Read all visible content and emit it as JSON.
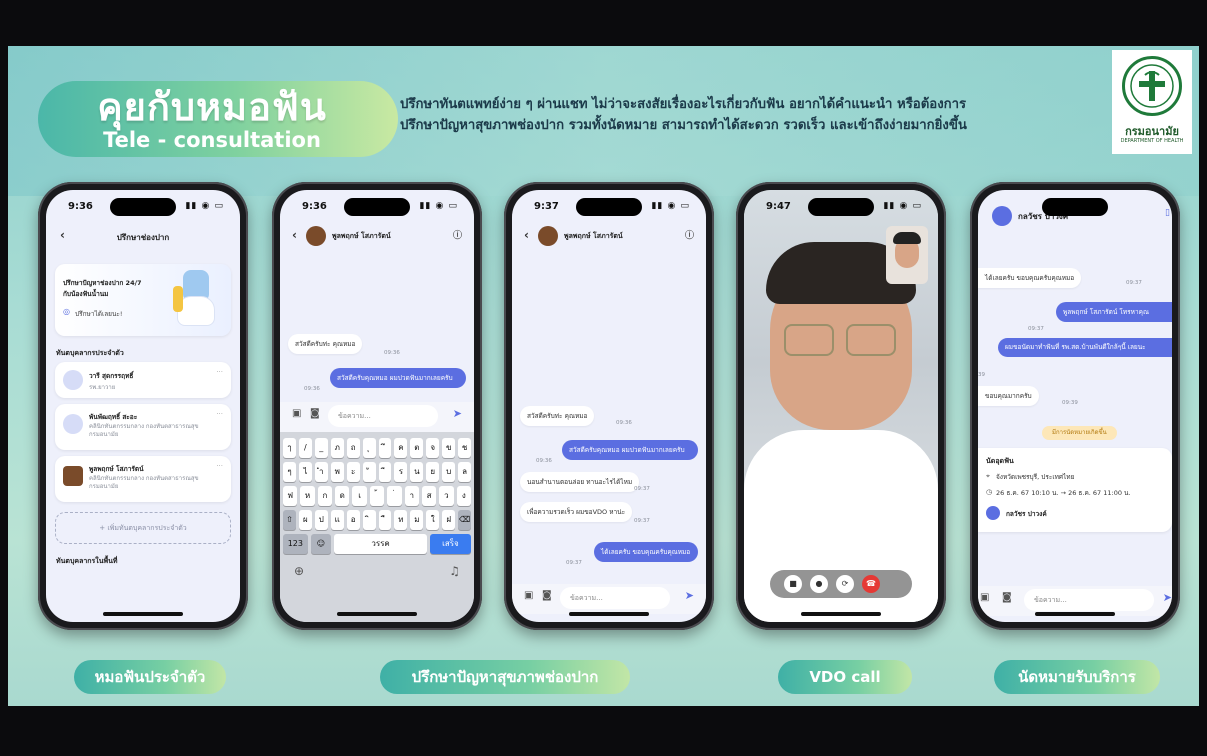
{
  "header": {
    "title_th": "คุยกับหมอฟัน",
    "title_en": "Tele - consultation",
    "description_line1": "ปรึกษาทันตแพทย์ง่าย ๆ ผ่านแชท ไม่ว่าจะสงสัยเรื่องอะไรเกี่ยวกับฟัน อยากได้คำแนะนำ หรือต้องการ",
    "description_line2": "ปรึกษาปัญหาสุขภาพช่องปาก รวมทั้งนัดหมาย สามารถทำได้สะดวก รวดเร็ว และเข้าถึงง่ายมากยิ่งขึ้น"
  },
  "logo": {
    "name_th": "กรมอนามัย",
    "name_en": "DEPARTMENT OF HEALTH"
  },
  "phone1": {
    "time": "9:36",
    "title": "ปรึกษาช่องปาก",
    "promo_line1": "ปรึกษาปัญหาช่องปาก 24/7",
    "promo_line2": "กับน้องฟันน้ำนม",
    "promo_link": "ปรึกษาได้เลยนะ!",
    "section1": "ทันตบุคลากรประจำตัว",
    "doctors": [
      {
        "name": "วารี สุดกรรฤทธิ์",
        "sub": "รพ.ยาวาย"
      },
      {
        "name": "พันพัฒฤทธิ์ สะอะ",
        "sub": "คลินิกทันตกรรมกลาง กองทันตสาธารณสุข กรมอนามัย"
      },
      {
        "name": "พูลพฤกษ์ โสภารัตน์",
        "sub": "คลินิกทันตกรรมกลาง กองทันตสาธารณสุข กรมอนามัย"
      }
    ],
    "add_label": "+ เพิ่มทันตบุคลากรประจำตัว",
    "section2": "ทันตบุคลากรในพื้นที่"
  },
  "phone2": {
    "time": "9:36",
    "contact": "พูลพฤกษ์ โสภารัตน์",
    "msg_in": "สวัสดีครับท่ะ คุณหมอ",
    "msg_in_time": "09:36",
    "msg_out": "สวัสดีครับคุณหมอ ผมปวดฟันมากเลยครับ",
    "msg_out_time": "09:36",
    "input_placeholder": "ข้อความ...",
    "kb_row1": [
      "ๅ",
      "/",
      "_",
      "ภ",
      "ถ",
      "ุ",
      "ึ",
      "ค",
      "ต",
      "จ",
      "ข",
      "ช"
    ],
    "kb_row2": [
      "ๆ",
      "ไ",
      "ำ",
      "พ",
      "ะ",
      "ั",
      "ี",
      "ร",
      "น",
      "ย",
      "บ",
      "ล"
    ],
    "kb_row3": [
      "ฟ",
      "ห",
      "ก",
      "ด",
      "เ",
      "้",
      "่",
      "า",
      "ส",
      "ว",
      "ง"
    ],
    "kb_row4": [
      "ผ",
      "ป",
      "แ",
      "อ",
      "ิ",
      "ื",
      "ท",
      "ม",
      "ใ",
      "ฝ"
    ],
    "kb_123": "123",
    "kb_space": "วรรค",
    "kb_done": "เสร็จ"
  },
  "phone3": {
    "time": "9:37",
    "contact": "พูลพฤกษ์ โสภารัตน์",
    "msg1": "สวัสดีครับท่ะ คุณหมอ",
    "msg1_time": "09:36",
    "msg2": "สวัสดีครับคุณหมอ ผมปวดฟันมากเลยครับ",
    "msg2_time": "09:36",
    "msg3": "นอนสำนานตอนล่อย ทานอะไรได้ไหม",
    "msg3_time": "09:37",
    "msg4": "เพื่อความรวดเร็ว ผมขอVDO หาน่ะ",
    "msg4_time": "09:37",
    "msg5": "ได้เลยครับ ขอบคุณครับคุณหมอ",
    "msg5_time": "09:37",
    "input_placeholder": "ข้อความ..."
  },
  "phone4": {
    "time": "9:47"
  },
  "phone5": {
    "contact": "กลวัชร ปาวงค์",
    "msg1": "ได้เลยครับ ขอบคุณครับคุณหมอ",
    "msg1_time": "09:37",
    "msg2": "พูลพฤกษ์ โสภารัตน์ โทรหาคุณ",
    "msg2_time": "09:37",
    "msg3": "ผมขอนัดมาทำฟันที่ รพ.สต.บ้านพันดีใกล้ๆนี้ เลยนะ",
    "msg3_time": "39",
    "msg4": "ขอบคุณมากครับ",
    "msg4_time": "09:39",
    "chip": "มีการนัดหมายเกิดขึ้น",
    "appt_title": "นัดอุดฟัน",
    "appt_location": "จังหวัดเพชรบุรี, ประเทศไทย",
    "appt_time": "26 ธ.ค. 67 10:10 น. → 26 ธ.ค. 67 11:00 น.",
    "appt_person": "กลวัชร ปาวงค์",
    "input_placeholder": "ข้อความ..."
  },
  "labels": {
    "l1": "หมอฟันประจำตัว",
    "l2": "ปรึกษาปัญหาสุขภาพช่องปาก",
    "l3": "VDO call",
    "l4": "นัดหมายรับบริการ"
  },
  "colors": {
    "accent": "#5b6ee1",
    "bubble_out": "#5b6ee1",
    "end_call": "#e53935"
  }
}
